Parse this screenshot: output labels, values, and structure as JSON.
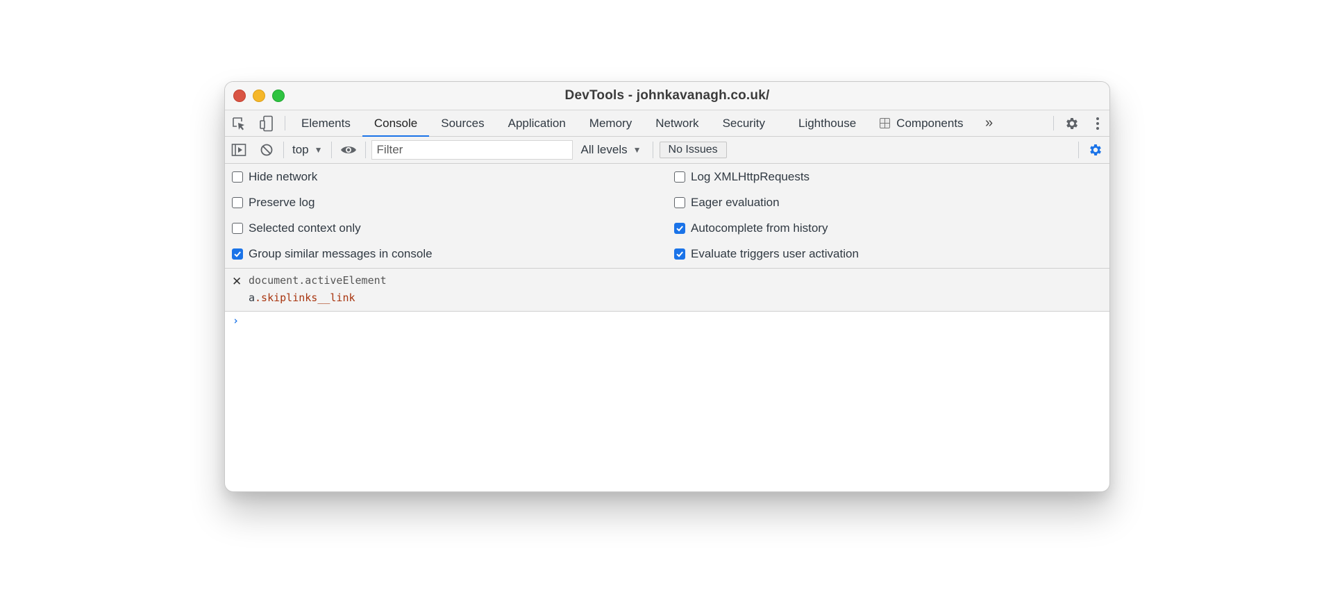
{
  "window": {
    "title": "DevTools - johnkavanagh.co.uk/"
  },
  "tabs": [
    {
      "label": "Elements"
    },
    {
      "label": "Console",
      "active": true
    },
    {
      "label": "Sources"
    },
    {
      "label": "Application"
    },
    {
      "label": "Memory"
    },
    {
      "label": "Network"
    },
    {
      "label": "Security"
    },
    {
      "label": "Lighthouse"
    },
    {
      "label": "Components",
      "icon": "components-icon"
    }
  ],
  "toolbar": {
    "context": "top",
    "filter_placeholder": "Filter",
    "levels": "All levels",
    "issues": "No Issues"
  },
  "settings": {
    "left": [
      {
        "label": "Hide network",
        "checked": false
      },
      {
        "label": "Preserve log",
        "checked": false
      },
      {
        "label": "Selected context only",
        "checked": false
      },
      {
        "label": "Group similar messages in console",
        "checked": true
      }
    ],
    "right": [
      {
        "label": "Log XMLHttpRequests",
        "checked": false
      },
      {
        "label": "Eager evaluation",
        "checked": false
      },
      {
        "label": "Autocomplete from history",
        "checked": true
      },
      {
        "label": "Evaluate triggers user activation",
        "checked": true
      }
    ]
  },
  "console": {
    "command": "document.activeElement",
    "result_tag": "a",
    "result_class": ".skiplinks__link"
  },
  "colors": {
    "accent": "#1a73e8",
    "result_class": "#a8350f"
  }
}
